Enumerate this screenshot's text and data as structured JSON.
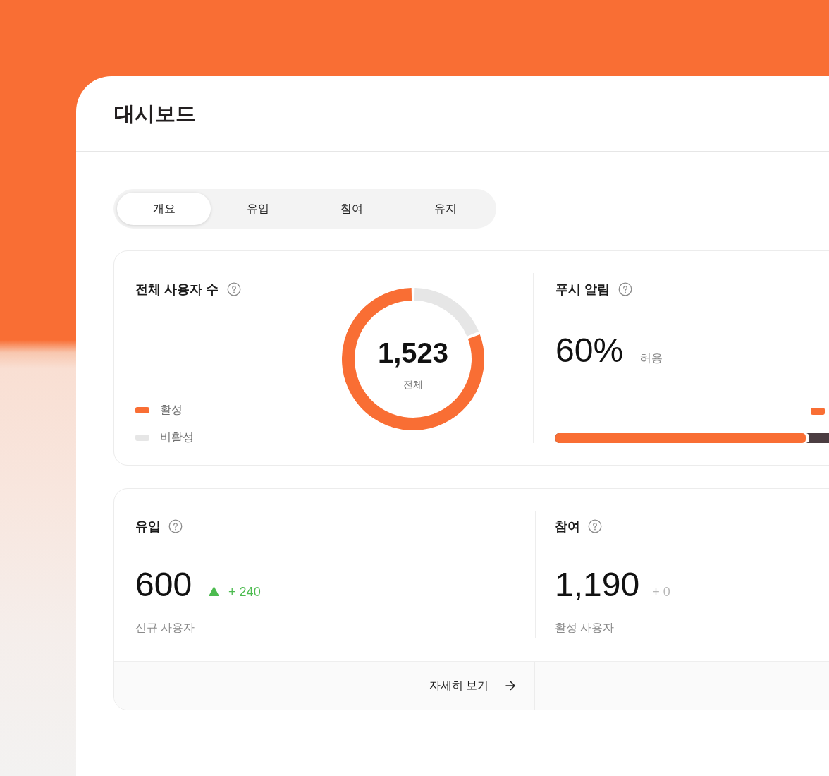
{
  "window": {
    "title": "대시보드"
  },
  "tabs": [
    {
      "label": "개요",
      "selected": true
    },
    {
      "label": "유입",
      "selected": false
    },
    {
      "label": "참여",
      "selected": false
    },
    {
      "label": "유지",
      "selected": false
    }
  ],
  "users_card": {
    "title": "전체 사용자 수",
    "total": "1,523",
    "total_label": "전체",
    "legend": [
      {
        "label": "활성",
        "color": "#f96e34"
      },
      {
        "label": "비활성",
        "color": "#e6e6e6"
      }
    ]
  },
  "push_card": {
    "title": "푸시 알림",
    "value": "60%",
    "value_label": "허용",
    "level": 0.6
  },
  "metrics": [
    {
      "title": "유입",
      "value": "600",
      "change": "+ 240",
      "kind": "increase",
      "caption": "신규 사용자",
      "footer_link": "자세히 보기"
    },
    {
      "title": "참여",
      "value": "1,190",
      "change": "+ 0",
      "kind": "unchanged",
      "caption": "활성 사용자"
    }
  ]
}
